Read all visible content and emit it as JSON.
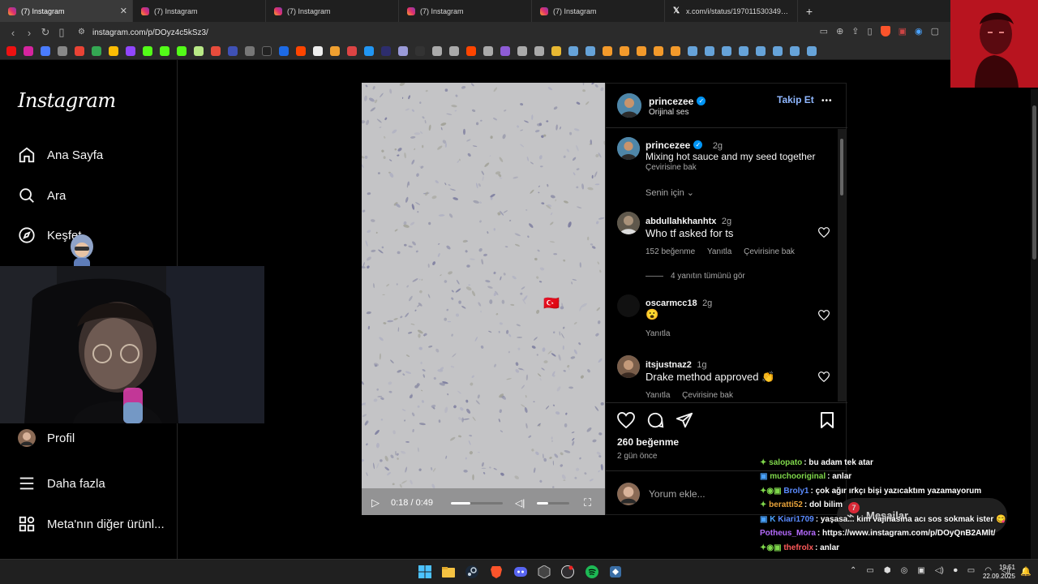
{
  "browser": {
    "tabs": [
      {
        "title": "(7) Instagram",
        "active": true
      },
      {
        "title": "(7) Instagram",
        "active": false
      },
      {
        "title": "(7) Instagram",
        "active": false
      },
      {
        "title": "(7) Instagram",
        "active": false
      },
      {
        "title": "(7) Instagram",
        "active": false
      },
      {
        "title": "x.com/i/status/1970115303490338...",
        "active": false
      }
    ],
    "new_tab": "+",
    "url": "instagram.com/p/DOyz4c5kSz3/"
  },
  "sidebar": {
    "logo": "Instagram",
    "items": [
      {
        "label": "Ana Sayfa",
        "icon": "home-icon"
      },
      {
        "label": "Ara",
        "icon": "search-icon"
      },
      {
        "label": "Keşfet",
        "icon": "compass-icon"
      },
      {
        "label": "Profil",
        "icon": "avatar"
      },
      {
        "label": "Daha fazla",
        "icon": "menu-icon"
      },
      {
        "label": "Meta'nın diğer ürünl...",
        "icon": "grid-icon"
      }
    ]
  },
  "video": {
    "time": "0:18 / 0:49",
    "progress": 0.37,
    "flag": "🇹🇷"
  },
  "post": {
    "author": "princezee",
    "audio": "Orijinal ses",
    "follow_label": "Takip Et",
    "more": "•••",
    "caption": {
      "user": "princezee",
      "age": "2g",
      "text": "Mixing hot sauce and my seed together",
      "translate": "Çevirisine bak"
    },
    "for_you": "Senin için",
    "comments": [
      {
        "user": "abdullahkhanhtx",
        "age": "2g",
        "text": "Who tf asked for ts",
        "likes": "152 beğenme",
        "reply": "Yanıtla",
        "translate": "Çevirisine bak",
        "view_replies": "4 yanıtın tümünü gör"
      },
      {
        "user": "oscarmcc18",
        "age": "2g",
        "text": "😮",
        "reply": "Yanıtla"
      },
      {
        "user": "itsjustnaz2",
        "age": "1g",
        "text": "Drake method approved 👏",
        "reply": "Yanıtla",
        "translate": "Çevirisine bak"
      }
    ],
    "likes": "260 beğenme",
    "date": "2 gün önce",
    "comment_placeholder": "Yorum ekle..."
  },
  "chat": [
    {
      "user": "salopato",
      "msg": ": bu adam tek atar",
      "color": "#7fd84b"
    },
    {
      "user": "muchooriginal",
      "msg": ": anlar",
      "color": "#7fd84b"
    },
    {
      "user": "Broly1",
      "msg": ": çok ağır ırkçı bişi yazıcaktım yazamayorum",
      "color": "#5b8cff"
    },
    {
      "user": "beratti52",
      "msg": ": dol bilim",
      "color": "#e8a33a"
    },
    {
      "user": "Kiari1709",
      "msg": ": yaşasa... kim vajinasına acı sos sokmak ister 😋",
      "color": "#5b8cff"
    },
    {
      "user": "Potheus_Mora",
      "msg": ": https://www.instagram.com/p/DOyQnB2AMlt/",
      "color": "#b66bff"
    },
    {
      "user": "thefrolx",
      "msg": ": anlar",
      "color": "#ff5a5a"
    }
  ],
  "messages_popup": {
    "label": "Mesajlar",
    "badge": "7"
  },
  "taskbar": {
    "time": "19:51",
    "date": "22.09.2025"
  }
}
